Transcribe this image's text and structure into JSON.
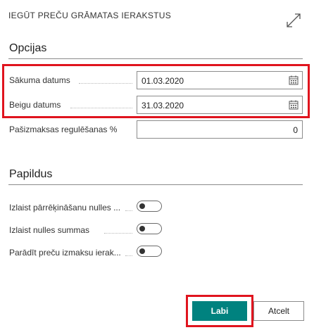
{
  "dialog": {
    "title": "IEGŪT PREČU GRĀMATAS IERAKSTUS",
    "expand_icon": "expand-arrows-icon"
  },
  "options": {
    "section_title": "Opcijas",
    "start_date_label": "Sākuma datums",
    "start_date_value": "01.03.2020",
    "end_date_label": "Beigu datums",
    "end_date_value": "31.03.2020",
    "cost_adj_label": "Pašizmaksas regulēšanas %",
    "cost_adj_value": "0",
    "calendar_icon": "calendar-icon"
  },
  "additional": {
    "section_title": "Papildus",
    "toggle1_label": "Izlaist pārrēķināšanu nulles ...",
    "toggle2_label": "Izlaist nulles summas",
    "toggle3_label": "Parādīt preču izmaksu ierak...",
    "toggle_state": "off"
  },
  "footer": {
    "ok_label": "Labi",
    "cancel_label": "Atcelt"
  },
  "colors": {
    "accent": "#00827f",
    "highlight": "#e0141e"
  }
}
